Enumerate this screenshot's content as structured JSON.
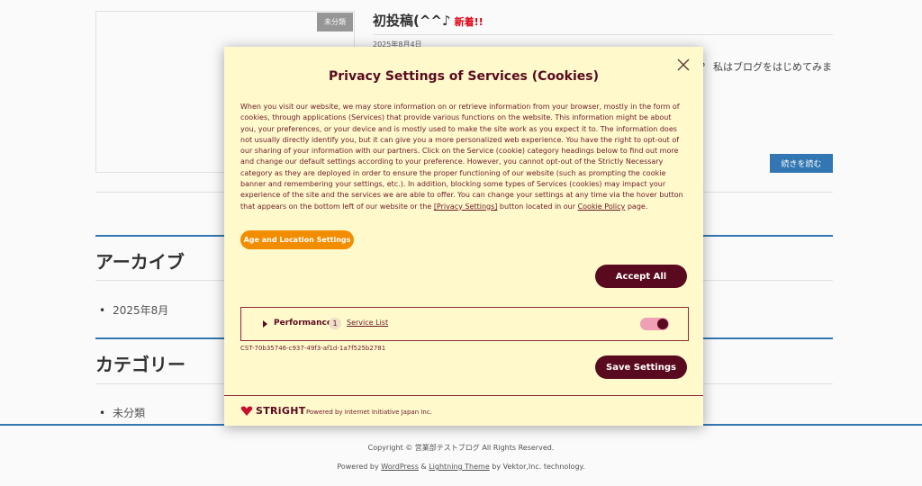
{
  "post": {
    "category_badge": "未分類",
    "title": "初投稿(^^♪",
    "new_label": "新着!!",
    "date": "2025年8月4日",
    "excerpt": "か？ 私はブログをはじめてみま",
    "read_more": "続きを読む"
  },
  "widgets": {
    "archive_title": "アーカイブ",
    "archive_items": [
      "2025年8月"
    ],
    "category_title": "カテゴリー",
    "category_items": [
      "未分類"
    ]
  },
  "footer": {
    "copyright": "Copyright © 営業部テストブログ All Rights Reserved.",
    "powered_prefix": "Powered by ",
    "wordpress": "WordPress",
    "amp": " & ",
    "theme": "Lightning Theme",
    "powered_suffix": " by Vektor,Inc. technology."
  },
  "modal": {
    "title": "Privacy Settings of Services (Cookies)",
    "body_pre": "When you visit our website, we may store information on or retrieve information from your browser, mostly in the form of cookies, through applications (Services) that provide various functions on the website. This information might be about you, your preferences, or your device and is mostly used to make the site work as you expect it to. The information does not usually directly identify you, but it can give you a more personalized web experience. You have the right to opt-out of our sharing of your information with our partners. Click on the Service (cookie) category headings below to find out more and change our default settings according to your preference. However, you cannot opt-out of the Strictly Necessary category as they are deployed in order to ensure the proper functioning of our website (such as prompting the cookie banner and remembering your settings, etc.). In addition, blocking some types of Services (cookies) may impact your experience of the site and the services we are able to offer. You can change your settings at any time via the hover button that appears on the bottom left of our website or the ",
    "privacy_link": "[Privacy Settings]",
    "body_mid": " button located in our ",
    "cookie_link": "Cookie Policy",
    "body_end": " page.",
    "age_button": "Age and Location Settings",
    "accept_button": "Accept All",
    "category_name": "Performance",
    "category_count": "1",
    "service_list_link": "Service List",
    "toggle_on": true,
    "consent_id": "CST-70b35746-c937-49f3-af1d-1a7f525b2781",
    "save_button": "Save Settings",
    "brand": "STRiGHT",
    "powered_by": "Powered by Internet Initiative Japan Inc.",
    "colors": {
      "primary": "#5a0a1e",
      "accent": "#f28c00",
      "background": "#fff9cc"
    }
  }
}
